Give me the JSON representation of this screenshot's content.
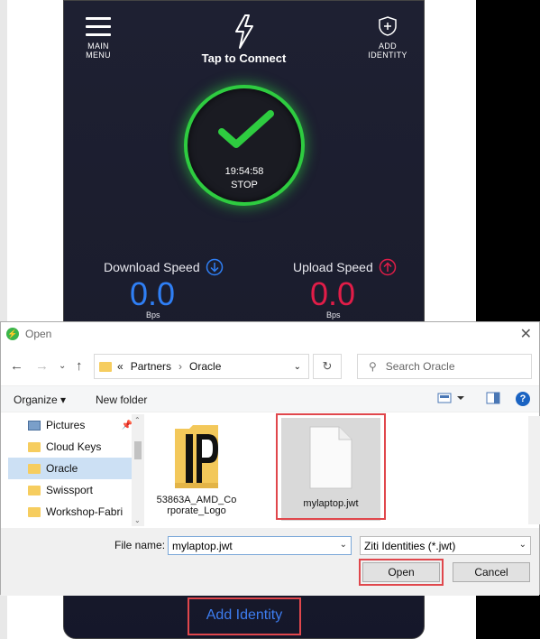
{
  "app": {
    "menu_label_line1": "MAIN",
    "menu_label_line2": "MENU",
    "add_identity_line1": "ADD",
    "add_identity_line2": "IDENTITY",
    "connect_label": "Tap to Connect",
    "timer": "19:54:58",
    "stop_label": "STOP",
    "download_label": "Download Speed",
    "upload_label": "Upload Speed",
    "download_value": "0.0",
    "upload_value": "0.0",
    "download_unit": "Bps",
    "upload_unit": "Bps",
    "add_identity_link": "Add Identity",
    "colors": {
      "connected": "#2ecc40",
      "download": "#2f7ff5",
      "upload": "#e11d48"
    }
  },
  "dialog": {
    "title": "Open",
    "address": {
      "prefix": "«",
      "segments": [
        "Partners",
        "Oracle"
      ],
      "separator": "›"
    },
    "search_placeholder": "Search Oracle",
    "toolbar": {
      "organize": "Organize ▾",
      "new_folder": "New folder"
    },
    "nav_items": [
      {
        "label": "Pictures"
      },
      {
        "label": "Cloud Keys"
      },
      {
        "label": "Oracle"
      },
      {
        "label": "Swissport"
      },
      {
        "label": "Workshop-Fabri"
      }
    ],
    "files": [
      {
        "line1": "53863A_AMD_Co",
        "line2": "rporate_Logo"
      },
      {
        "line1": "mylaptop.jwt"
      }
    ],
    "file_name_label": "File name:",
    "file_name_value": "mylaptop.jwt",
    "file_type": "Ziti Identities (*.jwt)",
    "open_button": "Open",
    "cancel_button": "Cancel"
  }
}
